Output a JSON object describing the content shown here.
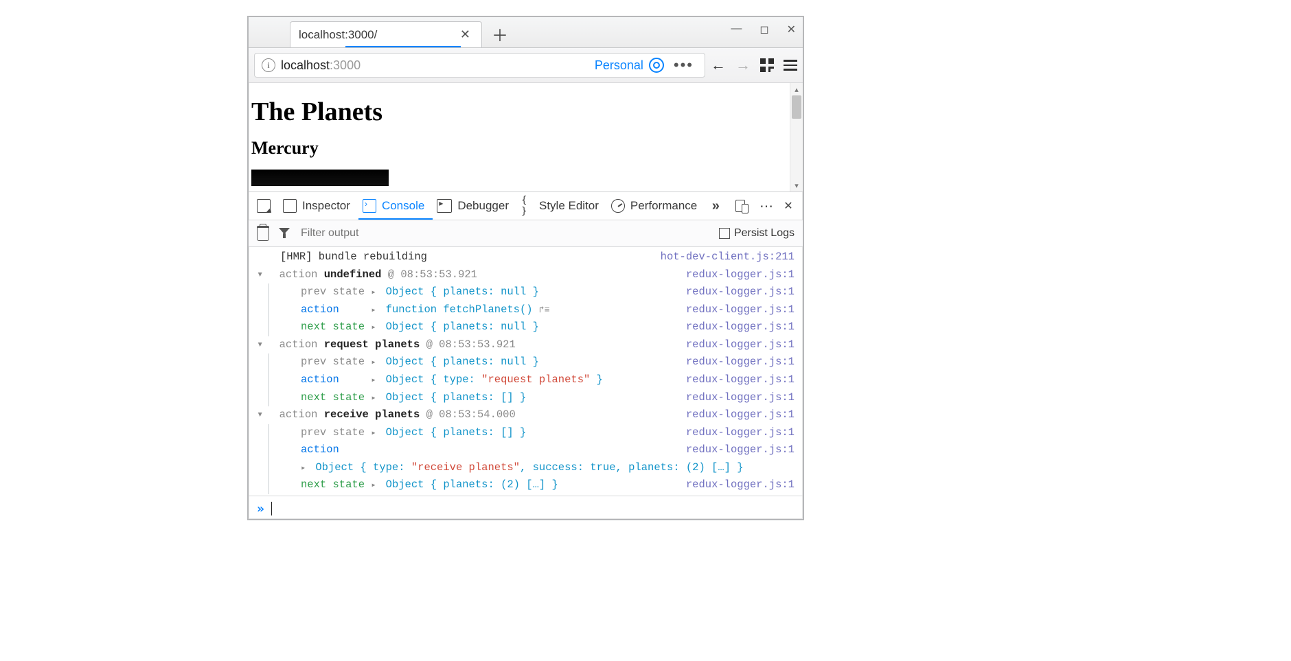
{
  "browser": {
    "tab_title": "localhost:3000/",
    "url_display_host": "localhost",
    "url_display_path": ":3000",
    "container_label": "Personal"
  },
  "page": {
    "heading": "The Planets",
    "subheading": "Mercury"
  },
  "devtools": {
    "tabs": {
      "inspector": "Inspector",
      "console": "Console",
      "debugger": "Debugger",
      "style_editor": "Style Editor",
      "performance": "Performance"
    },
    "filter_placeholder": "Filter output",
    "persist_label": "Persist Logs"
  },
  "console": {
    "src_hot": "hot-dev-client.js:211",
    "src_log": "redux-logger.js:1",
    "hmr_line": "[HMR] bundle rebuilding",
    "groups": [
      {
        "header_prefix": "action ",
        "header_name": "undefined",
        "header_time": " @ 08:53:53.921",
        "prev_label": "prev state",
        "prev_obj": "Object { planets: null }",
        "action_label": "action",
        "action_kind": "function",
        "action_body": "function fetchPlanets()",
        "next_label": "next state",
        "next_obj": "Object { planets: null }"
      },
      {
        "header_prefix": "action ",
        "header_name": "request planets",
        "header_time": " @ 08:53:53.921",
        "prev_label": "prev state",
        "prev_obj": "Object { planets: null }",
        "action_label": "action",
        "action_kind": "object",
        "action_body_pre": "Object { type: ",
        "action_body_str": "\"request planets\"",
        "action_body_post": " }",
        "next_label": "next state",
        "next_obj": "Object { planets: [] }"
      },
      {
        "header_prefix": "action ",
        "header_name": "receive planets",
        "header_time": " @ 08:53:54.000",
        "prev_label": "prev state",
        "prev_obj": "Object { planets: [] }",
        "action_label": "action",
        "action_kind": "object-multiline",
        "action_body_pre": "Object { type: ",
        "action_body_str": "\"receive planets\"",
        "action_body_mid": ", success: ",
        "action_body_bool": "true",
        "action_body_post": ", planets: (2) […] }",
        "next_label": "next state",
        "next_obj": "Object { planets: (2) […] }"
      }
    ]
  }
}
